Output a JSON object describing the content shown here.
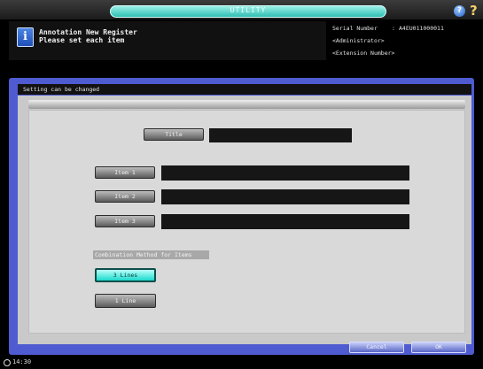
{
  "window": {
    "tab_title": "UTILITY"
  },
  "header": {
    "line1": "Annotation New Register",
    "line2": "Please set each item",
    "serial_label": "Serial Number",
    "serial_separator": ":",
    "serial_value": "A4EU011000011",
    "role": "<Administrator>",
    "extension": "<Extension Number>"
  },
  "status": {
    "message": "Setting can be changed"
  },
  "form": {
    "title_button": "Title",
    "title_value": "",
    "item1_button": "Item 1",
    "item1_value": "",
    "item2_button": "Item 2",
    "item2_value": "",
    "item3_button": "Item 3",
    "item3_value": "",
    "combination_label": "Combination Method for Items",
    "option_3_lines": "3 Lines",
    "option_1_line": "1 Line",
    "selected_option": "3 Lines"
  },
  "footer": {
    "cancel": "Cancel",
    "ok": "OK"
  },
  "clock": {
    "time": "14:30"
  },
  "colors": {
    "frame": "#4f5bd0",
    "selected": "#1ad9cc",
    "panel": "#d9d9d9"
  },
  "icons": [
    "info-icon",
    "help-icon",
    "question-icon",
    "clock-icon"
  ]
}
